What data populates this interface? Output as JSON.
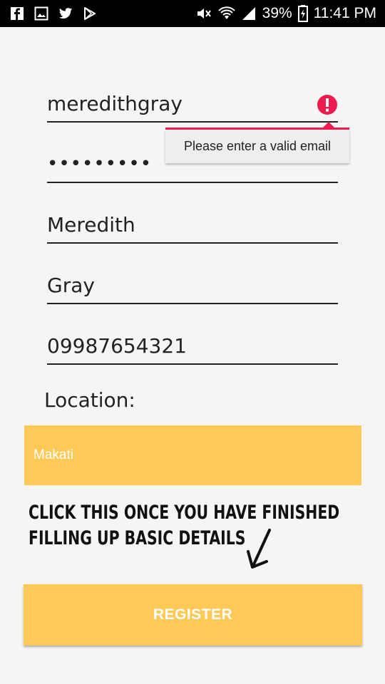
{
  "status_bar": {
    "icons_left": [
      "facebook-icon",
      "gallery-icon",
      "twitter-icon",
      "play-store-icon"
    ],
    "icons_right": [
      "mute-icon",
      "wifi-icon",
      "signal-icon"
    ],
    "battery": "39%",
    "time": "11:41 PM"
  },
  "form": {
    "username": "meredithgray",
    "password": "•••••••••",
    "first_name": "Meredith",
    "last_name": "Gray",
    "phone": "09987654321",
    "error_message": "Please enter a valid email",
    "error_color": "#ee1c4e",
    "location_label": "Location:",
    "location_value": "Makati",
    "accent_color": "#fec956"
  },
  "annotation": {
    "line1": "CLICK THIS ONCE YOU HAVE FINISHED",
    "line2": "FILLING UP BASIC DETAILS"
  },
  "register_button": {
    "label": "REGISTER"
  }
}
